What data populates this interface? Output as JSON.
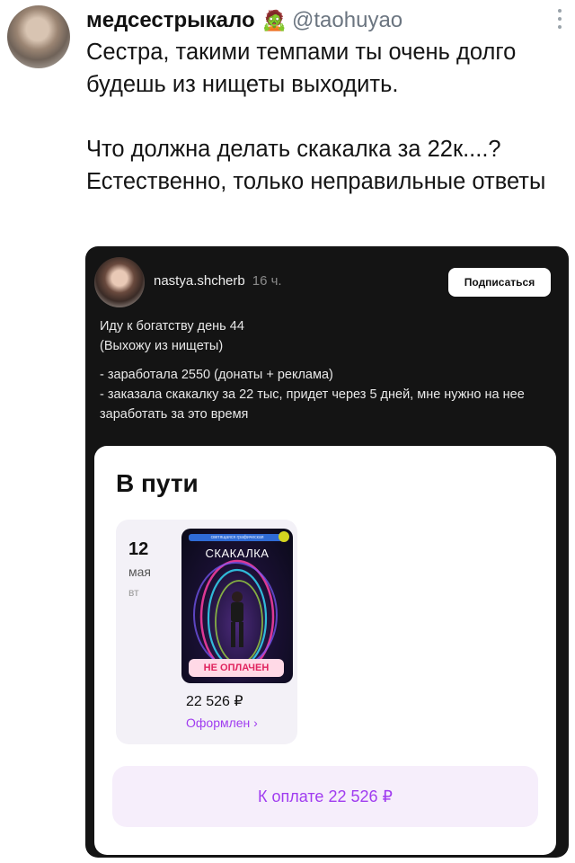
{
  "tweet": {
    "display_name": "медсестрыкало",
    "emoji": "🧟",
    "handle": "@taohuyao",
    "text_line1": "Сестра, такими темпами ты очень долго будешь из нищеты выходить.",
    "text_line2": "Что должна делать скакалка за 22к....? Естественно, только неправильные ответы"
  },
  "embedded_post": {
    "username": "nastya.shcherb",
    "time": "16 ч.",
    "subscribe_label": "Подписаться",
    "lines": [
      "Иду к богатству день 44",
      "(Выхожу из нищеты)",
      "- заработала 2550 (донаты + реклама)",
      "- заказала скакалку за 22 тыс, придет через 5 дней, мне нужно на нее заработать за это время"
    ]
  },
  "order_panel": {
    "title": "В пути",
    "day": "12",
    "month": "мая",
    "weekday": "вт",
    "product_banner": "светящаяся графическая",
    "product_title": "СКАКАЛКА",
    "badge": "НЕ ОПЛАЧЕН",
    "price": "22 526 ₽",
    "status": "Оформлен ›",
    "pay_label": "К оплате 22 526 ₽"
  },
  "colors": {
    "accent": "#a03cf0",
    "badge_text": "#e0245e",
    "card_bg": "#141414"
  }
}
